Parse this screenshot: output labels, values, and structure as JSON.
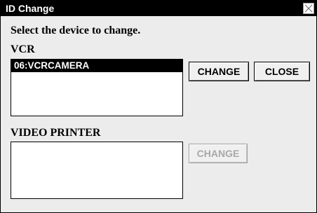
{
  "window": {
    "title": "ID Change"
  },
  "instruction": "Select the device to change.",
  "vcr": {
    "label": "VCR",
    "items": [
      "06:VCRCAMERA"
    ],
    "selected_index": 0,
    "change_label": "CHANGE",
    "close_label": "CLOSE"
  },
  "printer": {
    "label": "VIDEO PRINTER",
    "items": [],
    "change_label": "CHANGE",
    "change_enabled": false
  }
}
